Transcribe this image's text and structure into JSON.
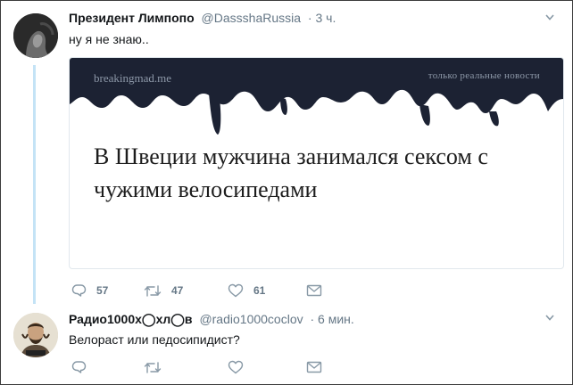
{
  "tweet": {
    "author_name": "Президент Лимпопо",
    "author_handle": "@DassshaRussia",
    "time": "· 3 ч.",
    "text": "ну я не знаю..",
    "card": {
      "site": "breakingmad.me",
      "tagline": "только реальные новости",
      "headline": "В Швеции мужчина занимался сексом с чужими велосипедами",
      "banner_color": "#1c2233"
    },
    "actions": {
      "reply_count": "57",
      "retweet_count": "47",
      "like_count": "61"
    }
  },
  "reply": {
    "author_name": "Радио1000х◯хл◯в",
    "author_handle": "@radio1000coclov",
    "time": "· 6 мин.",
    "text": "Велораст или педосипидист?",
    "actions": {
      "reply_count": "",
      "retweet_count": "",
      "like_count": ""
    }
  },
  "icons": {
    "reply": "reply-icon",
    "retweet": "retweet-icon",
    "like": "heart-icon",
    "message": "envelope-icon",
    "more": "chevron-down-icon"
  },
  "colors": {
    "thread_line": "#c4e3f6",
    "muted": "#657786",
    "card_border": "#e1e8ed"
  }
}
